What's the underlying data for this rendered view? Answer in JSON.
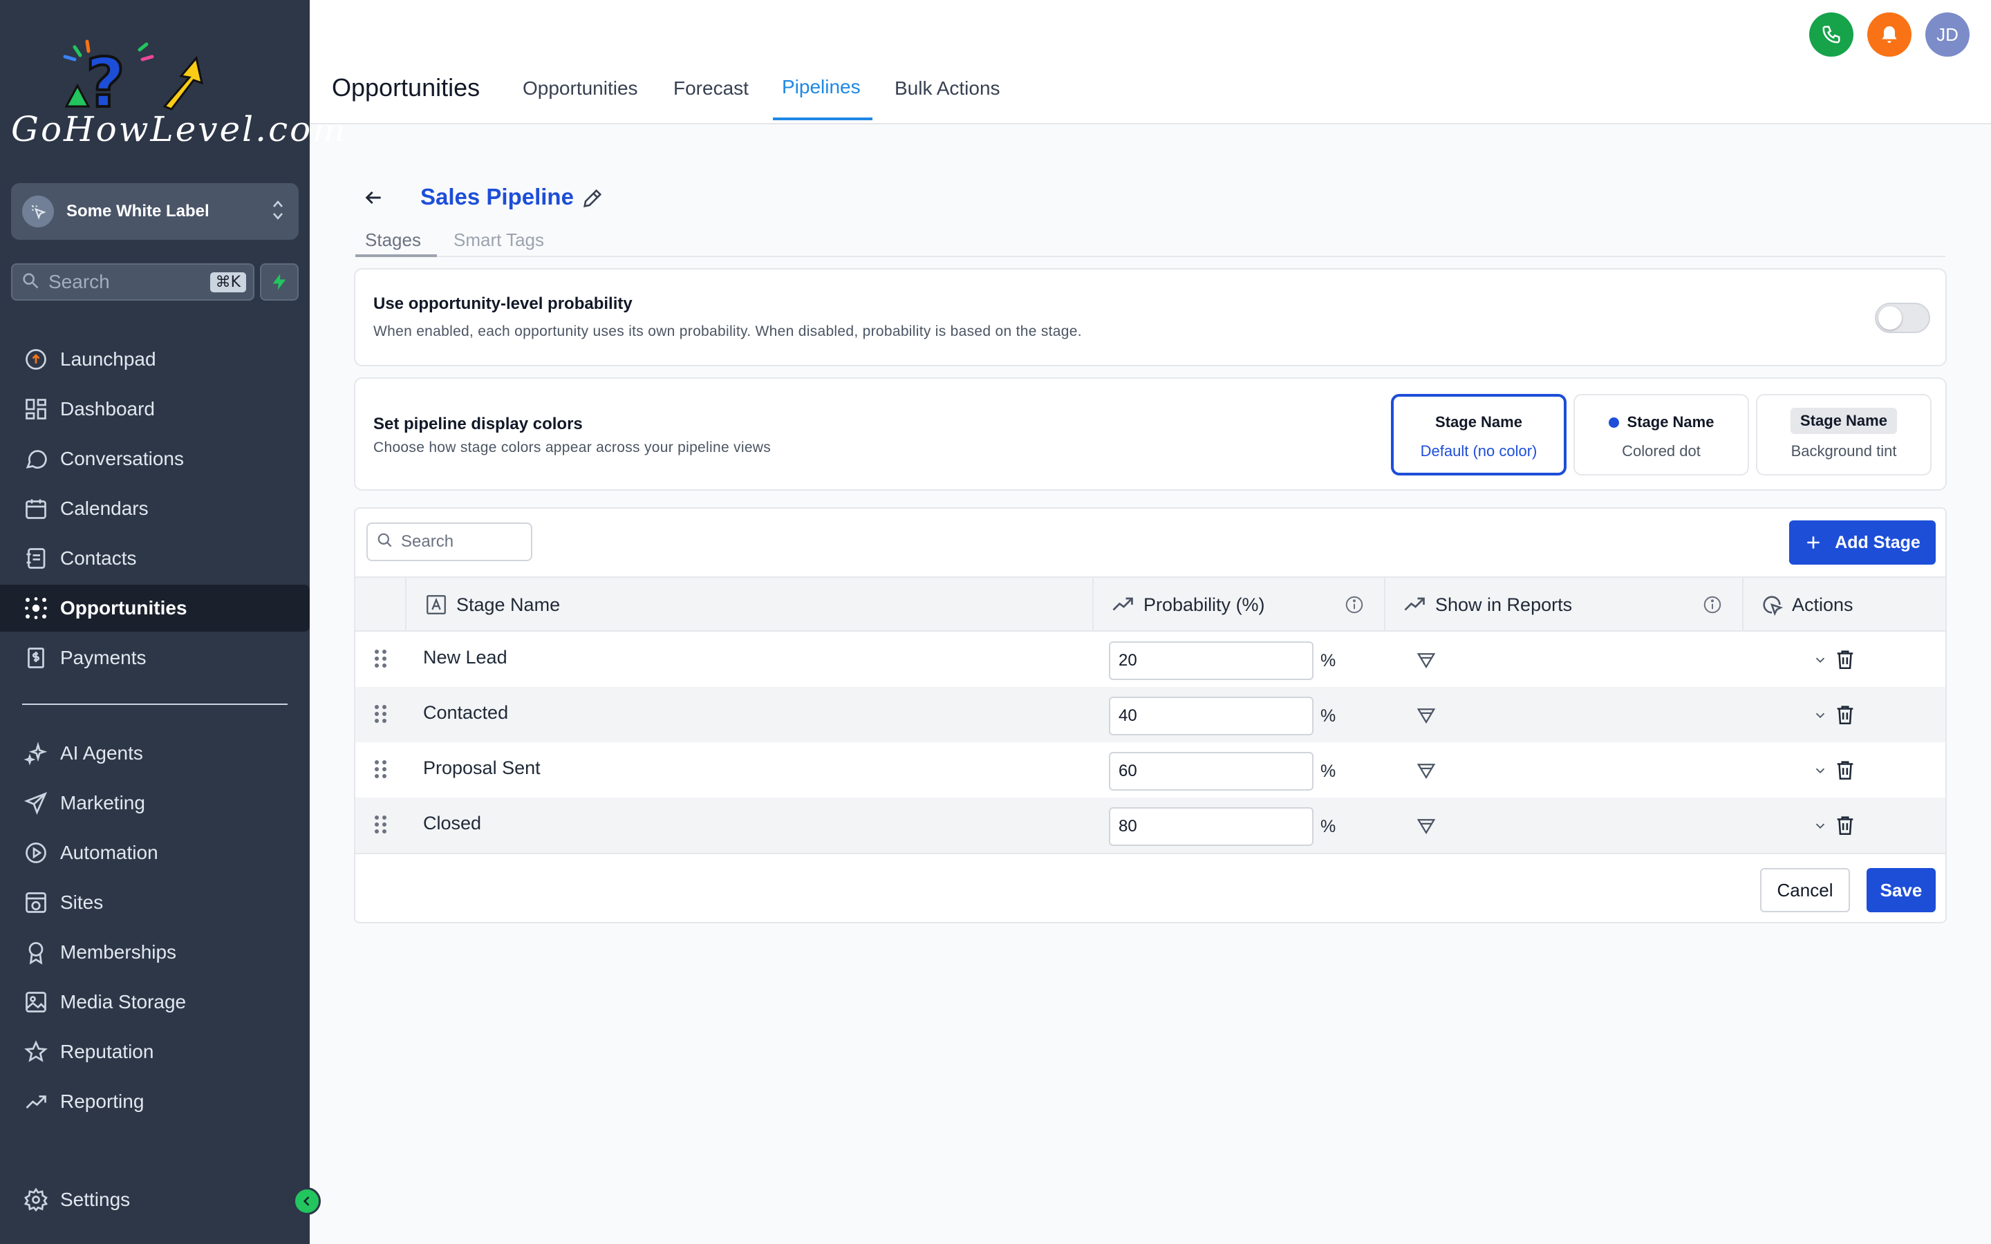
{
  "brand": {
    "logo_text": "GoHowLevel.com",
    "colors": {
      "sidebar_bg": "#2d3748",
      "accent": "#1d4ed8",
      "tab_active": "#1e88e5",
      "phone": "#16a34a",
      "notify": "#f97316"
    }
  },
  "sidebar": {
    "account_name": "Some White Label",
    "search_placeholder": "Search",
    "search_shortcut": "⌘K",
    "items": [
      {
        "label": "Launchpad",
        "icon": "launchpad-icon"
      },
      {
        "label": "Dashboard",
        "icon": "dashboard-icon"
      },
      {
        "label": "Conversations",
        "icon": "chat-icon"
      },
      {
        "label": "Calendars",
        "icon": "calendar-icon"
      },
      {
        "label": "Contacts",
        "icon": "contacts-icon"
      },
      {
        "label": "Opportunities",
        "icon": "opportunities-icon",
        "active": true
      },
      {
        "label": "Payments",
        "icon": "payments-icon"
      },
      {
        "label": "AI Agents",
        "icon": "sparkle-icon"
      },
      {
        "label": "Marketing",
        "icon": "send-icon"
      },
      {
        "label": "Automation",
        "icon": "automation-icon"
      },
      {
        "label": "Sites",
        "icon": "sites-icon"
      },
      {
        "label": "Memberships",
        "icon": "badge-icon"
      },
      {
        "label": "Media Storage",
        "icon": "image-icon"
      },
      {
        "label": "Reputation",
        "icon": "star-icon"
      },
      {
        "label": "Reporting",
        "icon": "trend-icon"
      }
    ],
    "settings_label": "Settings"
  },
  "topbar": {
    "title": "Opportunities",
    "tabs": [
      "Opportunities",
      "Forecast",
      "Pipelines",
      "Bulk Actions"
    ],
    "active_tab": "Pipelines",
    "avatar_initials": "JD"
  },
  "pipeline": {
    "name": "Sales Pipeline",
    "subtabs": [
      "Stages",
      "Smart Tags"
    ],
    "active_subtab": "Stages"
  },
  "probability_setting": {
    "title": "Use opportunity-level probability",
    "description": "When enabled, each opportunity uses its own probability. When disabled, probability is based on the stage.",
    "enabled": false
  },
  "display_colors": {
    "title": "Set pipeline display colors",
    "description": "Choose how stage colors appear across your pipeline views",
    "options": [
      {
        "name": "Stage Name",
        "label": "Default (no color)",
        "selected": true
      },
      {
        "name": "Stage Name",
        "label": "Colored dot",
        "selected": false
      },
      {
        "name": "Stage Name",
        "label": "Background tint",
        "selected": false
      }
    ]
  },
  "stages": {
    "search_placeholder": "Search",
    "add_button": "Add Stage",
    "columns": [
      "Stage Name",
      "Probability (%)",
      "Show in Reports",
      "Actions"
    ],
    "rows": [
      {
        "name": "New Lead",
        "probability": "20",
        "unit": "%"
      },
      {
        "name": "Contacted",
        "probability": "40",
        "unit": "%"
      },
      {
        "name": "Proposal Sent",
        "probability": "60",
        "unit": "%"
      },
      {
        "name": "Closed",
        "probability": "80",
        "unit": "%"
      }
    ],
    "cancel_label": "Cancel",
    "save_label": "Save"
  }
}
